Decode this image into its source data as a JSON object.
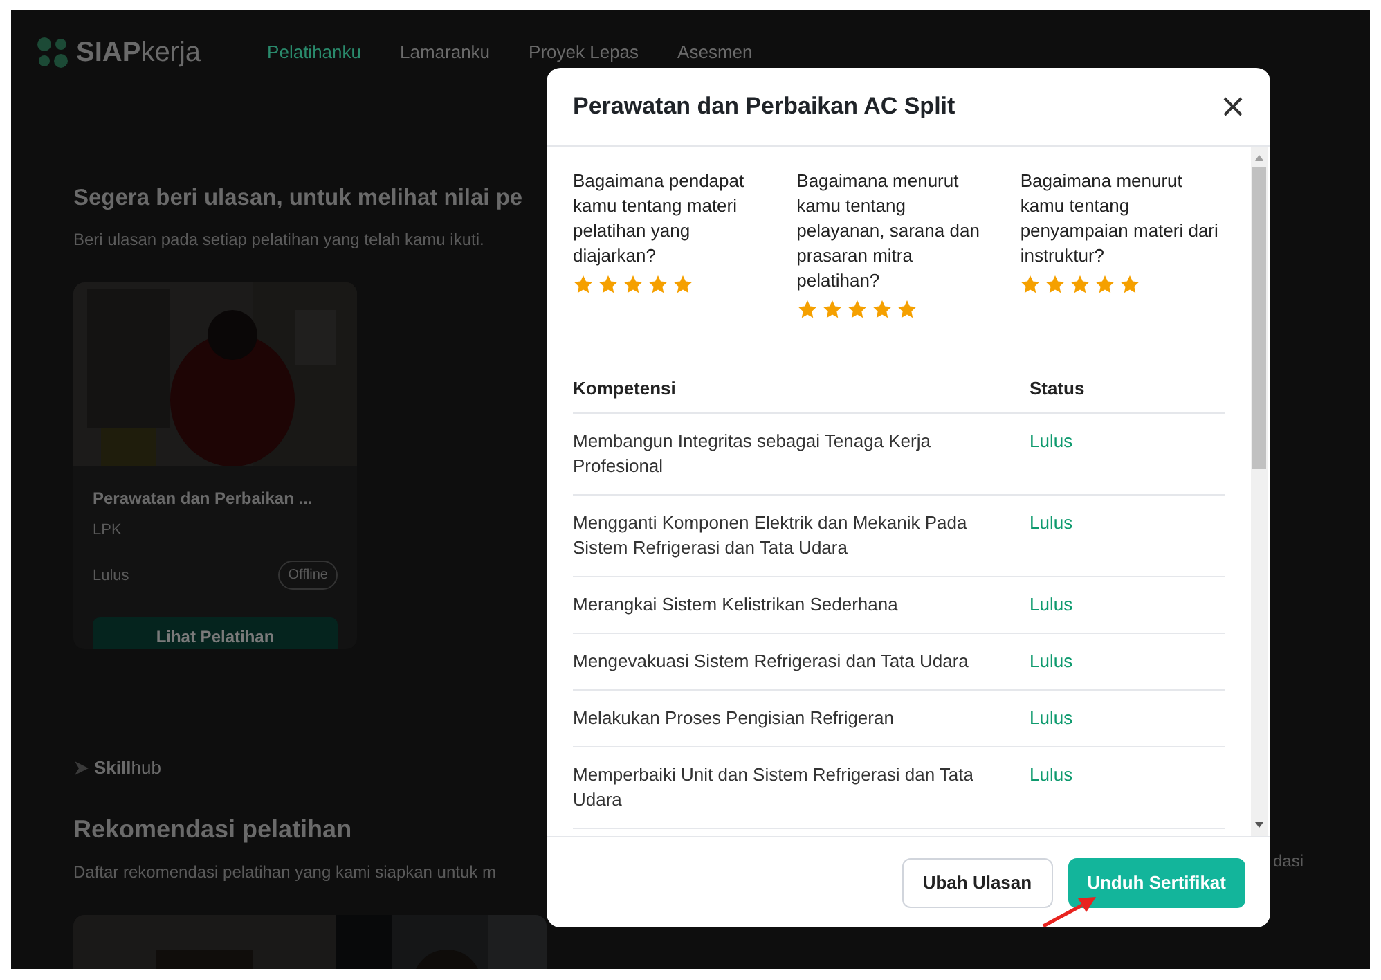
{
  "nav": {
    "logo": {
      "brand_bold": "SIAP",
      "brand_light": "kerja"
    },
    "items": [
      {
        "label": "Pelatihanku",
        "selected": true
      },
      {
        "label": "Lamaranku",
        "selected": false
      },
      {
        "label": "Proyek Lepas",
        "selected": false
      },
      {
        "label": "Asesmen",
        "selected": false
      }
    ]
  },
  "review_section": {
    "title": "Segera beri ulasan, untuk melihat nilai pe",
    "subtitle": "Beri ulasan pada setiap pelatihan yang telah kamu ikuti.",
    "card": {
      "title": "Perawatan dan Perbaikan ...",
      "provider": "LPK",
      "status": "Lulus",
      "mode": "Offline",
      "button": "Lihat Pelatihan"
    }
  },
  "partner_logo": {
    "bold": "Skill",
    "light": "hub"
  },
  "recommendation_section": {
    "title": "Rekomendasi pelatihan",
    "subtitle": "Daftar rekomendasi pelatihan yang kami siapkan untuk m",
    "side_text": "dasi"
  },
  "modal": {
    "title": "Perawatan dan Perbaikan AC Split",
    "questions": [
      {
        "text": "Bagaimana pendapat kamu tentang materi pelatihan yang diajarkan?",
        "stars": 5
      },
      {
        "text": "Bagaimana menurut kamu tentang pelayanan, sarana dan prasaran mitra pelatihan?",
        "stars": 5
      },
      {
        "text": "Bagaimana menurut kamu tentang penyampaian materi dari instruktur?",
        "stars": 5
      }
    ],
    "table": {
      "columns": [
        "Kompetensi",
        "Status"
      ],
      "rows": [
        {
          "competency": "Membangun Integritas sebagai Tenaga Kerja Profesional",
          "status": "Lulus"
        },
        {
          "competency": "Mengganti Komponen Elektrik dan Mekanik Pada Sistem Refrigerasi dan Tata Udara",
          "status": "Lulus"
        },
        {
          "competency": "Merangkai Sistem Kelistrikan Sederhana",
          "status": "Lulus"
        },
        {
          "competency": "Mengevakuasi Sistem Refrigerasi dan Tata Udara",
          "status": "Lulus"
        },
        {
          "competency": "Melakukan Proses Pengisian Refrigeran",
          "status": "Lulus"
        },
        {
          "competency": "Memperbaiki Unit dan Sistem Refrigerasi dan Tata Udara",
          "status": "Lulus"
        }
      ]
    },
    "buttons": [
      {
        "label": "Ubah Ulasan",
        "kind": "secondary"
      },
      {
        "label": "Unduh Sertifikat",
        "kind": "primary"
      }
    ]
  }
}
